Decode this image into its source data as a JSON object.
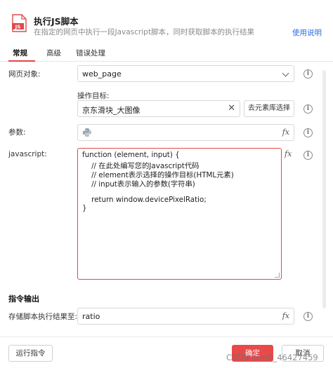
{
  "header": {
    "icon_label": "JS",
    "title": "执行JS脚本",
    "subtitle": "在指定的网页中执行一段Javascript脚本，同时获取脚本的执行结果",
    "help_link": "使用说明"
  },
  "tabs": [
    {
      "label": "常规",
      "active": true
    },
    {
      "label": "高级",
      "active": false
    },
    {
      "label": "错误处理",
      "active": false
    }
  ],
  "form": {
    "webpage": {
      "label": "网页对象:",
      "value": "web_page"
    },
    "target": {
      "label": "操作目标:",
      "value": "京东滑块_大图像",
      "library_button": "去元素库选择"
    },
    "params": {
      "label": "参数:",
      "value": ""
    },
    "javascript": {
      "label": "javascript:",
      "code": [
        "function (element, input) {",
        "    // 在此处编写您的Javascript代码",
        "    // element表示选择的操作目标(HTML元素)",
        "    // input表示输入的参数(字符串)",
        "",
        "    return window.devicePixelRatio;",
        "}"
      ]
    }
  },
  "output": {
    "section_title": "指令输出",
    "store": {
      "label": "存储脚本执行结果至:",
      "value": "ratio"
    }
  },
  "footer": {
    "run_label": "运行指令",
    "ok_label": "确定",
    "cancel_label": "取消"
  },
  "watermark": "CSDN @m0_46427459",
  "colors": {
    "accent": "#e84a4a",
    "link": "#2a6ce8"
  }
}
